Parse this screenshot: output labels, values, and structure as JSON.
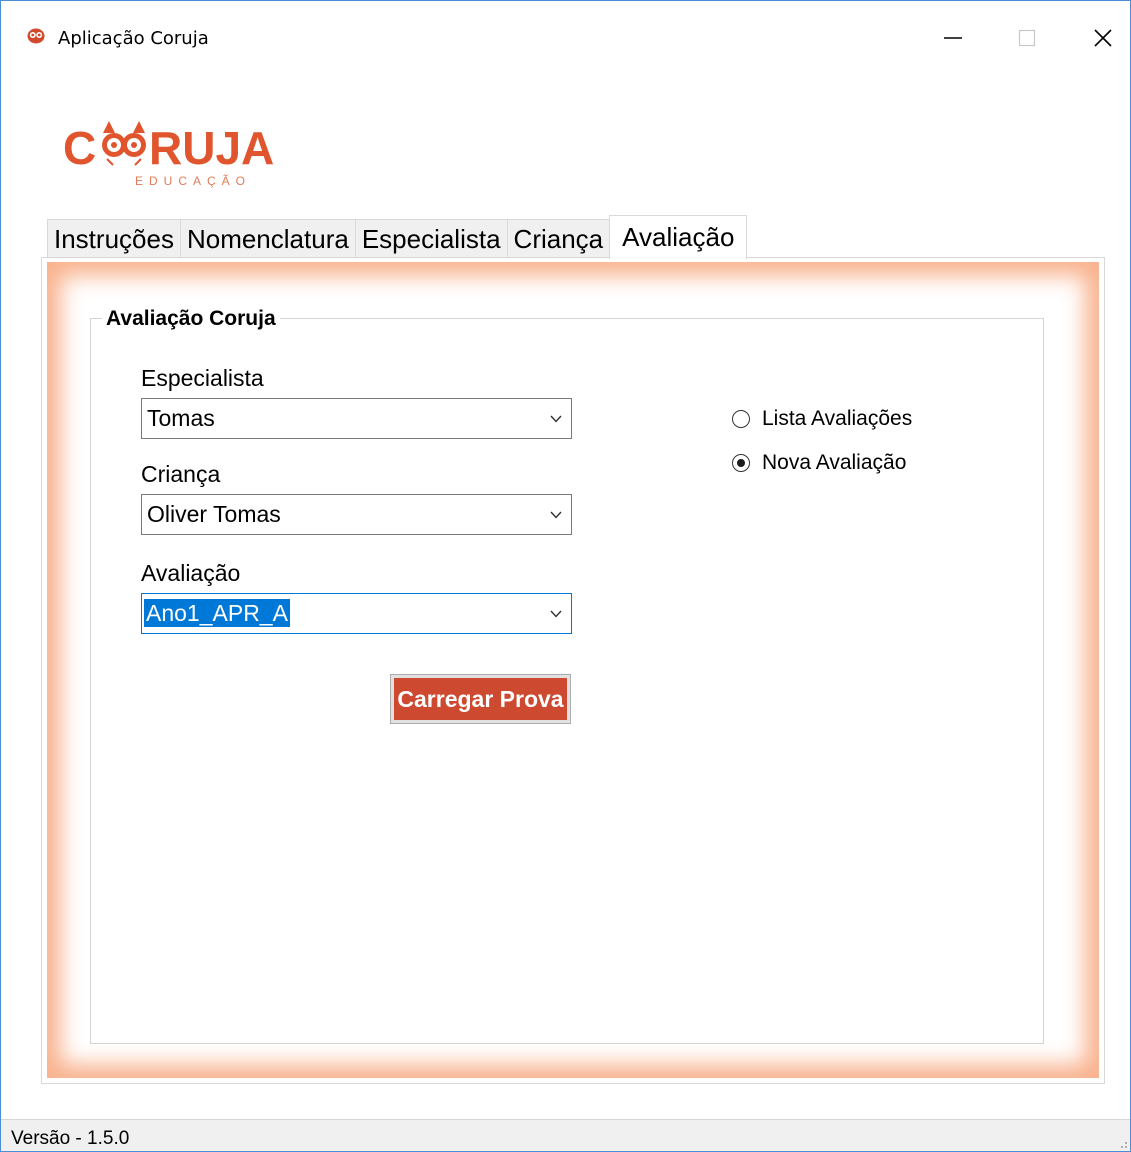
{
  "window": {
    "title": "Aplicação Coruja",
    "minimize_icon": "minimize-icon",
    "maximize_icon": "maximize-icon",
    "close_icon": "close-icon"
  },
  "logo": {
    "brand": "CORUJA",
    "tagline": "EDUCAÇÃO",
    "brand_color": "#e0552d",
    "tagline_color": "#e37a5a"
  },
  "tabs": [
    {
      "label": "Instruções",
      "active": false
    },
    {
      "label": "Nomenclatura",
      "active": false
    },
    {
      "label": "Especialista",
      "active": false
    },
    {
      "label": "Criança",
      "active": false
    },
    {
      "label": "Avaliação",
      "active": true
    }
  ],
  "group": {
    "title": "Avaliação Coruja"
  },
  "form": {
    "especialista": {
      "label": "Especialista",
      "value": "Tomas"
    },
    "crianca": {
      "label": "Criança",
      "value": "Oliver Tomas"
    },
    "avaliacao": {
      "label": "Avaliação",
      "value": "Ano1_APR_A"
    }
  },
  "load_button": {
    "label": "Carregar Prova",
    "color": "#cd4930"
  },
  "radios": [
    {
      "label": "Lista Avaliações",
      "checked": false
    },
    {
      "label": "Nova Avaliação",
      "checked": true
    }
  ],
  "status": {
    "version": "Versão - 1.5.0"
  },
  "colors": {
    "accent": "#0078d7",
    "frame_glow": "#f9b38f"
  }
}
